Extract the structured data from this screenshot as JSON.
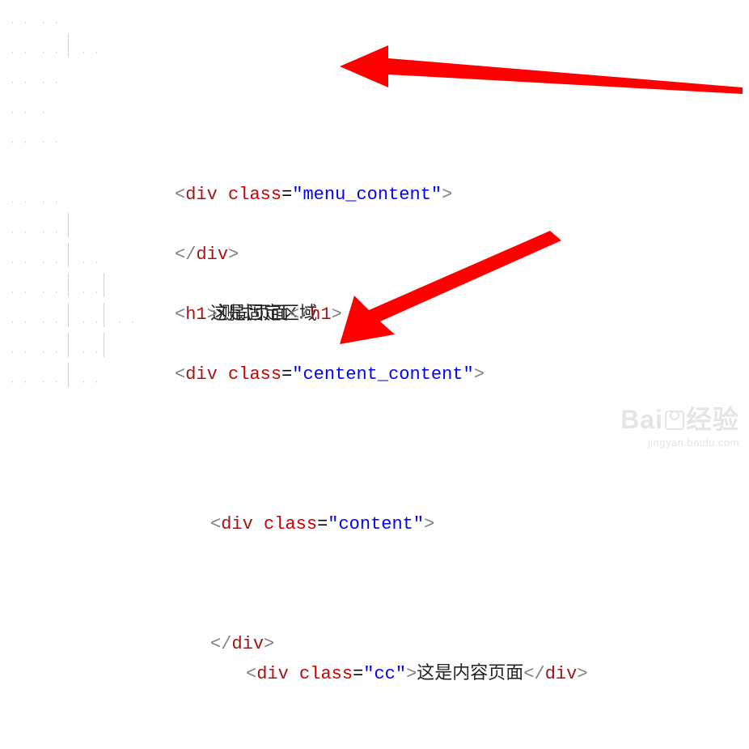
{
  "code": {
    "lines": [
      {
        "indent": 2,
        "open_tag": "div",
        "attr": "class",
        "val": "\"menu_content\"",
        "type": "open"
      },
      {
        "indent": 3,
        "text": "这是固定区域",
        "type": "text"
      },
      {
        "indent": 2,
        "close_tag": "div",
        "type": "close"
      },
      {
        "indent": 1,
        "type": "blank"
      },
      {
        "indent": 2,
        "open_tag": "h1",
        "text": "测试页面",
        "close_tag": "h1",
        "type": "inline"
      },
      {
        "indent": 1,
        "type": "blank"
      },
      {
        "indent": 2,
        "open_tag": "div",
        "attr": "class",
        "val": "\"centent_content\"",
        "type": "open"
      },
      {
        "indent": 2,
        "type": "blank"
      },
      {
        "indent": 3,
        "open_tag": "div",
        "attr": "class",
        "val": "\"content\"",
        "type": "open"
      },
      {
        "indent": 3,
        "type": "blank"
      },
      {
        "indent": 4,
        "open_tag": "div",
        "attr": "class",
        "val": "\"cc\"",
        "text": "这是内容页面",
        "close_tag": "div",
        "type": "inline-attr"
      },
      {
        "indent": 3,
        "type": "blank"
      },
      {
        "indent": 3,
        "close_tag": "div",
        "type": "close"
      }
    ]
  },
  "tokens": {
    "lt": "<",
    "gt": ">",
    "lts": "</",
    "sp": " ",
    "eq": "="
  },
  "text": {
    "menu_text": "这是固定区域",
    "h1_text": "测试页面",
    "cc_text": "这是内容页面"
  },
  "classes": {
    "menu": "menu_content",
    "centent": "centent_content",
    "content": "content",
    "cc": "cc"
  },
  "watermark": {
    "logo": "Bai du 经验",
    "url": "jingyan.baidu.com"
  },
  "annotations": {
    "arrow1": "red-arrow-pointing-left",
    "arrow2": "red-arrow-pointing-down-left"
  }
}
